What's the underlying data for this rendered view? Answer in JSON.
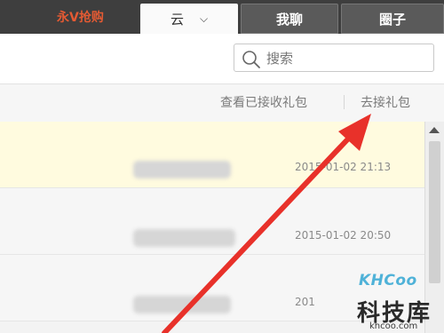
{
  "header": {
    "brand": "永V抢购",
    "tabs": [
      {
        "label": "云",
        "chevron": "⌵"
      },
      {
        "label": "我聊"
      },
      {
        "label": "圈子"
      }
    ]
  },
  "search": {
    "placeholder": "搜索"
  },
  "links": {
    "received": "查看已接收礼包",
    "go": "去接礼包"
  },
  "rows": [
    {
      "time": "2015-01-02 21:13"
    },
    {
      "time": "2015-01-02 20:50"
    },
    {
      "time": "201"
    }
  ],
  "watermark": {
    "brand": "KHCoo",
    "name": "科技库",
    "url": "khcoo.com"
  },
  "colors": {
    "accent": "#e35a33",
    "highlight_row": "#fffbdf",
    "annotation_arrow": "#e8312a"
  }
}
